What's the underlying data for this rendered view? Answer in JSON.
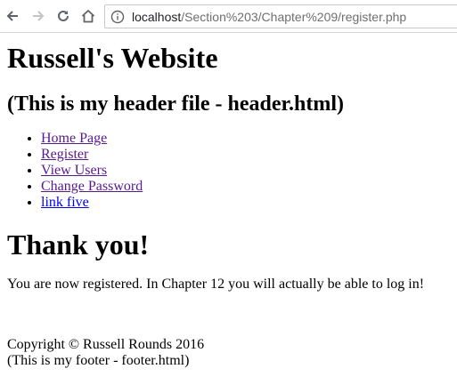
{
  "browser": {
    "url_host": "localhost",
    "url_path": "/Section%203/Chapter%209/register.php"
  },
  "header": {
    "title": "Russell's Website",
    "subtitle": "(This is my header file - header.html)"
  },
  "nav": {
    "items": [
      {
        "label": "Home Page"
      },
      {
        "label": "Register"
      },
      {
        "label": "View Users"
      },
      {
        "label": "Change Password"
      },
      {
        "label": "link five"
      }
    ]
  },
  "main": {
    "heading": "Thank you!",
    "message": "You are now registered. In Chapter 12 you will actually be able to log in!"
  },
  "footer": {
    "copyright": "Copyright © Russell Rounds 2016",
    "note": "(This is my footer - footer.html)"
  },
  "colors": {
    "visited_link": "#551a8b",
    "unvisited_link": "#0000ee"
  },
  "icons": [
    "back-arrow-icon",
    "forward-arrow-icon",
    "reload-icon",
    "home-icon",
    "info-icon"
  ]
}
